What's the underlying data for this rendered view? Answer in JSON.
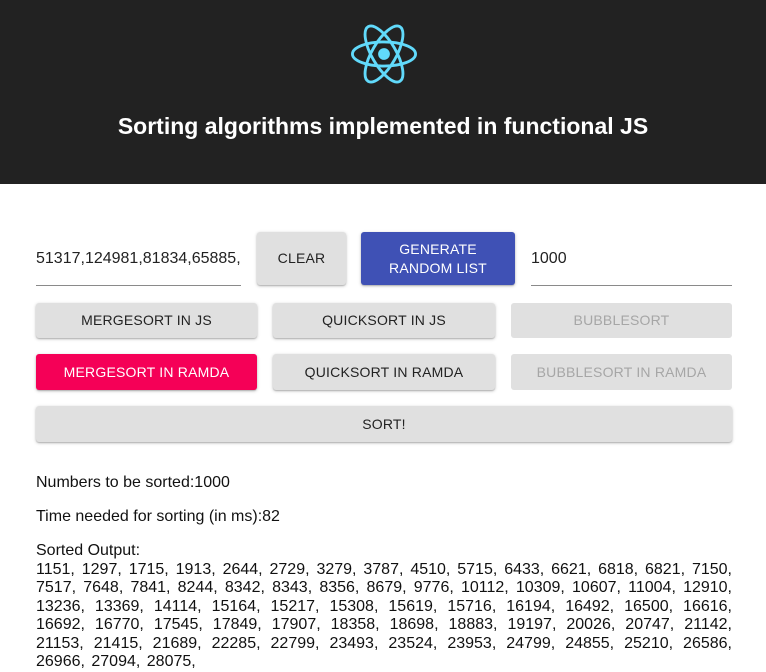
{
  "header": {
    "title": "Sorting algorithms implemented in functional JS",
    "logo_icon": "react-atom-icon",
    "logo_color": "#61dafb",
    "background": "#222222"
  },
  "controls": {
    "list_input_value": "51317,124981,81834,65885,",
    "clear_label": "CLEAR",
    "generate_label_line1": "GENERATE",
    "generate_label_line2": "RANDOM LIST",
    "count_input_value": "1000"
  },
  "algorithms": {
    "mergesort_js": "MERGESORT IN JS",
    "quicksort_js": "QUICKSORT IN JS",
    "bubblesort": "BUBBLESORT",
    "mergesort_ramda": "MERGESORT IN RAMDA",
    "quicksort_ramda": "QUICKSORT IN RAMDA",
    "bubblesort_ramda": "BUBBLESORT IN RAMDA",
    "sort_label": "SORT!"
  },
  "colors": {
    "primary": "#3f51b5",
    "secondary": "#f50057",
    "default_button": "#e0e0e0"
  },
  "results": {
    "count_text": "Numbers to be sorted:1000",
    "time_text": "Time needed for sorting (in ms):82",
    "output_label": "Sorted Output:",
    "output_numbers": "1151, 1297, 1715, 1913, 2644, 2729, 3279, 3787, 4510, 5715, 6433, 6621, 6818, 6821, 7150, 7517, 7648, 7841, 8244, 8342, 8343, 8356, 8679, 9776, 10112, 10309, 10607, 11004, 12910, 13236, 13369, 14114, 15164, 15217, 15308, 15619, 15716, 16194, 16492, 16500, 16616, 16692, 16770, 17545, 17849, 17907, 18358, 18698, 18883, 19197, 20026, 20747, 21142, 21153, 21415, 21689, 22285, 22799, 23493, 23524, 23953, 24799, 24855, 25210, 26586, 26966, 27094, 28075,"
  }
}
